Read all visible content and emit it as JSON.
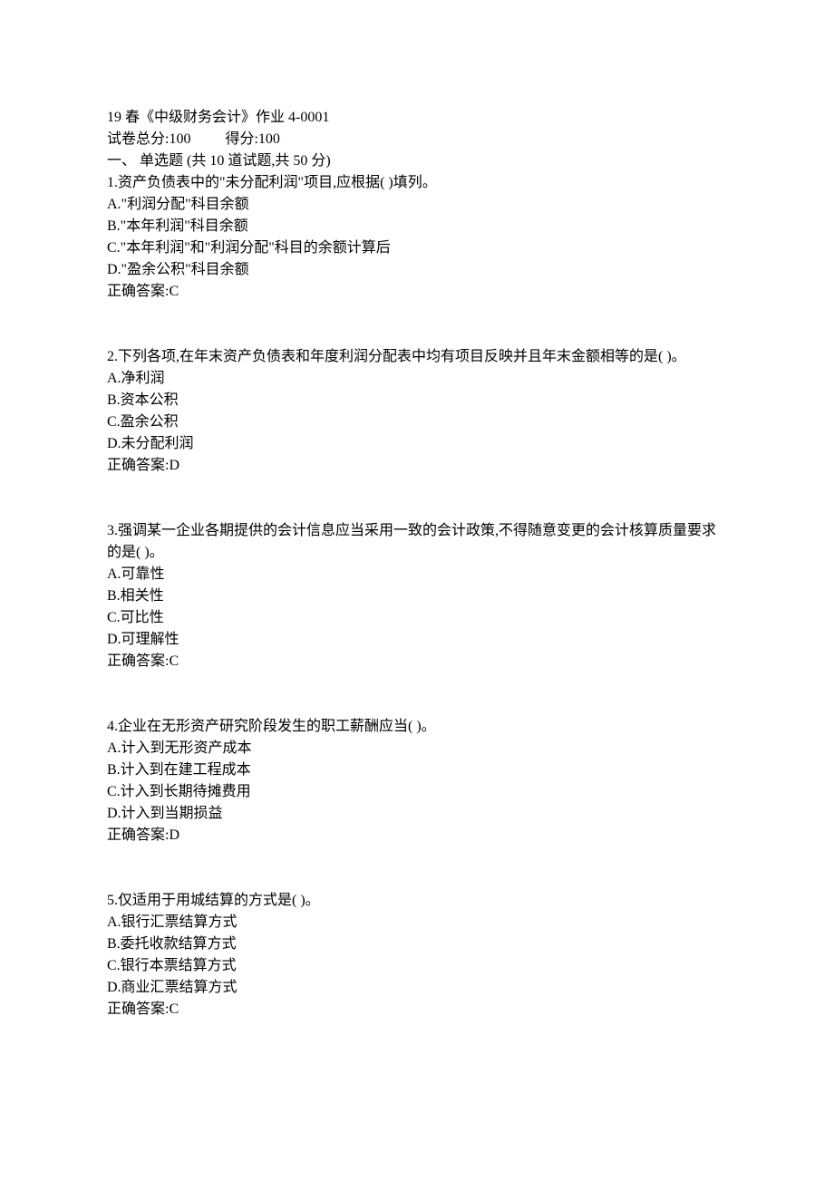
{
  "header": {
    "title": "19 春《中级财务会计》作业 4-0001",
    "total_score_label": "试卷总分:100",
    "score_label": "得分:100",
    "section": "一、  单选题 (共 10 道试题,共 50 分)"
  },
  "questions": [
    {
      "stem": "1.资产负债表中的\"未分配利润\"项目,应根据( )填列。",
      "options": [
        "A.\"利润分配\"科目余额",
        "B.\"本年利润\"科目余额",
        "C.\"本年利润\"和\"利润分配\"科目的余额计算后",
        "D.\"盈余公积\"科目余额"
      ],
      "answer": "正确答案:C"
    },
    {
      "stem": "2.下列各项,在年末资产负债表和年度利润分配表中均有项目反映并且年末金额相等的是( )。",
      "options": [
        "A.净利润",
        "B.资本公积",
        "C.盈余公积",
        "D.未分配利润"
      ],
      "answer": "正确答案:D"
    },
    {
      "stem": "3.强调某一企业各期提供的会计信息应当采用一致的会计政策,不得随意变更的会计核算质量要求的是( )。",
      "options": [
        "A.可靠性",
        "B.相关性",
        "C.可比性",
        "D.可理解性"
      ],
      "answer": "正确答案:C"
    },
    {
      "stem": "4.企业在无形资产研究阶段发生的职工薪酬应当( )。",
      "options": [
        "A.计入到无形资产成本",
        "B.计入到在建工程成本",
        "C.计入到长期待摊费用",
        "D.计入到当期损益"
      ],
      "answer": "正确答案:D"
    },
    {
      "stem": "5.仅适用于用城结算的方式是( )。",
      "options": [
        "A.银行汇票结算方式",
        "B.委托收款结算方式",
        "C.银行本票结算方式",
        "D.商业汇票结算方式"
      ],
      "answer": "正确答案:C"
    }
  ]
}
